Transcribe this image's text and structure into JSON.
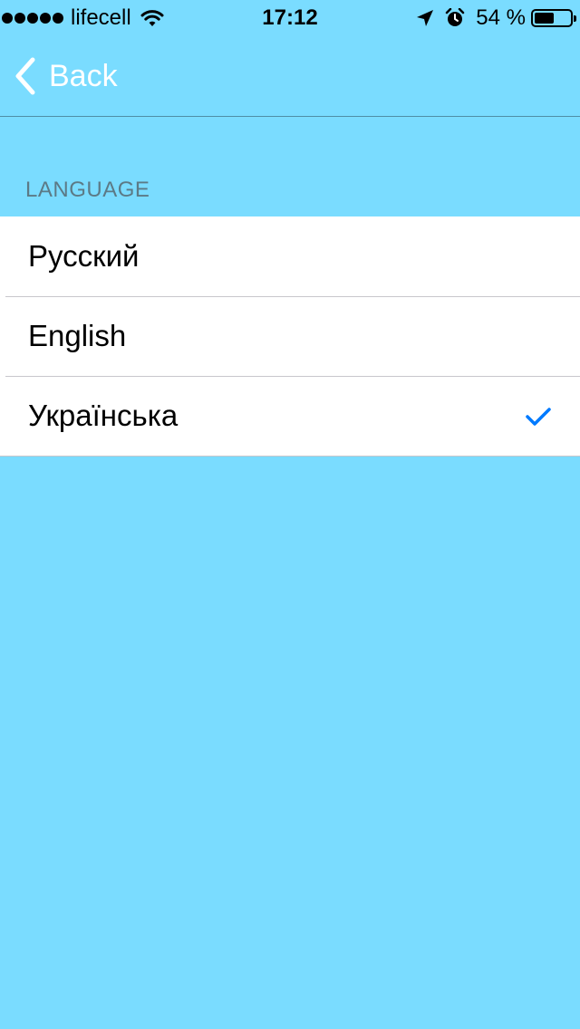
{
  "status_bar": {
    "carrier": "lifecell",
    "signal_bars": 5,
    "time": "17:12",
    "battery_percent": "54 %",
    "battery_level": 0.54,
    "icons": [
      "wifi-icon",
      "location-arrow-icon",
      "alarm-clock-icon",
      "battery-icon"
    ]
  },
  "nav": {
    "back_label": "Back"
  },
  "section": {
    "header": "LANGUAGE",
    "items": [
      {
        "label": "Русский",
        "selected": false
      },
      {
        "label": "English",
        "selected": false
      },
      {
        "label": "Українська",
        "selected": true
      }
    ]
  },
  "colors": {
    "background": "#7adcff",
    "accent": "#007aff",
    "cell_background": "#ffffff",
    "section_header": "#5c7a86"
  }
}
